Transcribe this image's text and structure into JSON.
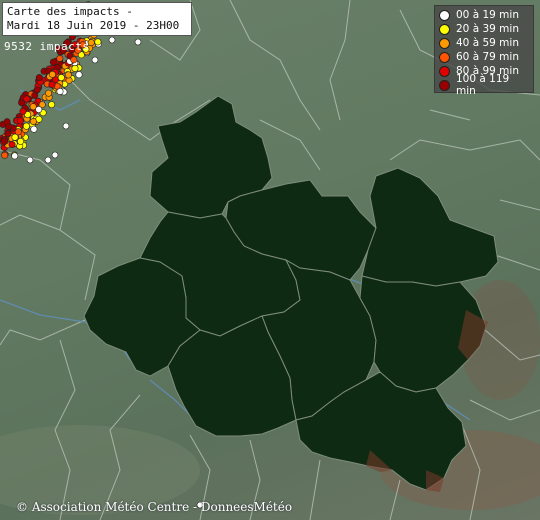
{
  "map": {
    "title_line1": "Carte des impacts -",
    "title_line2": "Mardi 18 Juin 2019 - 23H00",
    "impact_count": "9532 impacts",
    "credit": "© Association Météo Centre - DonneesMétéo",
    "colors": {
      "region_fill": "#0e2a12",
      "region_border": "#7d8c7b",
      "outer_borders": "#b9c3b8",
      "rivers": "#5f8eb8",
      "relief": "#8a4a3a"
    }
  },
  "legend": {
    "items": [
      {
        "label": "00 à 19 min",
        "color": "#ffffff"
      },
      {
        "label": "20 à 39 min",
        "color": "#ffff00"
      },
      {
        "label": "40 à 59 min",
        "color": "#ff9900"
      },
      {
        "label": "60 à 79 min",
        "color": "#ff5500"
      },
      {
        "label": "80 à 99 min",
        "color": "#e00000"
      },
      {
        "label": "100 à 119 min",
        "color": "#9b0000"
      }
    ]
  }
}
